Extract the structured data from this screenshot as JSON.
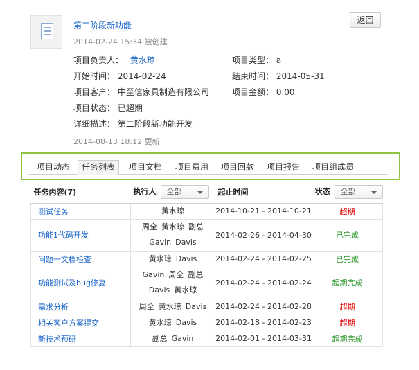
{
  "project": {
    "title": "第二阶段新功能",
    "created": "2014-02-24 15:34 被创建",
    "back_label": "返回",
    "fields": {
      "owner_label": "项目负责人：",
      "owner_value": "黄水琼",
      "type_label": "项目类型：",
      "type_value": "a",
      "start_label": "开始时间：",
      "start_value": "2014-02-24",
      "end_label": "结束时间：",
      "end_value": "2014-05-31",
      "client_label": "项目客户：",
      "client_value": "中至信家具制造有限公司",
      "amount_label": "项目金额：",
      "amount_value": "0.00",
      "status_label": "项目状态：",
      "status_value": "已超期",
      "desc_label": "详细描述：",
      "desc_value": "第二阶段新功能开发"
    },
    "updated": "2014-08-13 18:12 更新"
  },
  "tabs": [
    {
      "label": "项目动态",
      "active": false
    },
    {
      "label": "任务列表",
      "active": true
    },
    {
      "label": "项目文档",
      "active": false
    },
    {
      "label": "项目费用",
      "active": false
    },
    {
      "label": "项目回款",
      "active": false
    },
    {
      "label": "项目报告",
      "active": false
    },
    {
      "label": "项目组成员",
      "active": false
    }
  ],
  "tasks": {
    "headers": {
      "name": "任务内容(7)",
      "assignee": "执行人",
      "assignee_filter": "全部",
      "period": "起止时间",
      "status": "状态",
      "status_filter": "全部"
    },
    "rows": [
      {
        "name": "测试任务",
        "people": [
          [
            "黄水琼"
          ]
        ],
        "period": "2014-10-21 - 2014-10-21",
        "status": "超期",
        "status_kind": "over"
      },
      {
        "name": "功能1代码开发",
        "people": [
          [
            "周全",
            "黄水琼",
            "副总"
          ],
          [
            "Gavin",
            "Davis"
          ]
        ],
        "period": "2014-02-26 - 2014-04-30",
        "status": "已完成",
        "status_kind": "done"
      },
      {
        "name": "问题一文档检查",
        "people": [
          [
            "黄水琼",
            "Davis"
          ]
        ],
        "period": "2014-02-24 - 2014-02-25",
        "status": "已完成",
        "status_kind": "done"
      },
      {
        "name": "功能测试及bug修复",
        "people": [
          [
            "Gavin",
            "周全",
            "副总"
          ],
          [
            "Davis",
            "黄水琼"
          ]
        ],
        "period": "2014-02-24 - 2014-02-24",
        "status": "超期完成",
        "status_kind": "late"
      },
      {
        "name": "需求分析",
        "people": [
          [
            "周全",
            "黄水琼",
            "Davis"
          ]
        ],
        "period": "2014-02-24 - 2014-02-28",
        "status": "超期",
        "status_kind": "over"
      },
      {
        "name": "相关客户方案提交",
        "people": [
          [
            "黄水琼",
            "Davis"
          ]
        ],
        "period": "2014-02-18 - 2014-02-23",
        "status": "超期",
        "status_kind": "over"
      },
      {
        "name": "新技术预研",
        "people": [
          [
            "副总",
            "Gavin"
          ]
        ],
        "period": "2014-02-01 - 2014-03-31",
        "status": "超期完成",
        "status_kind": "late"
      }
    ]
  },
  "icons": {
    "project": "document-icon",
    "filter": "chevron-down-icon"
  }
}
